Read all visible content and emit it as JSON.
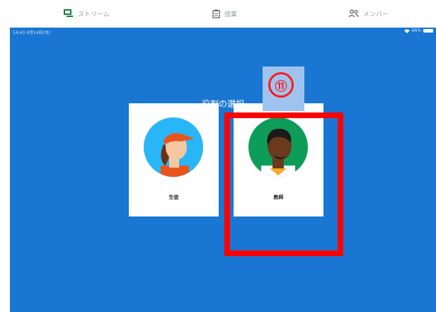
{
  "tabs": [
    {
      "label": "ストリーム",
      "icon": "stream-icon"
    },
    {
      "label": "授業",
      "icon": "clipboard-icon"
    },
    {
      "label": "メンバー",
      "icon": "people-icon"
    }
  ],
  "status_bar": {
    "time": "14:43 4月14日(水)",
    "battery": "96%"
  },
  "dialog": {
    "title": "役割の選択",
    "roles": [
      {
        "label": "生徒",
        "icon": "student-avatar-icon"
      },
      {
        "label": "教師",
        "icon": "teacher-avatar-icon"
      }
    ]
  },
  "annotation": {
    "step": "⑪",
    "color": "#ff0000"
  },
  "colors": {
    "accent": "#1976d2",
    "tab_green": "#188038"
  }
}
